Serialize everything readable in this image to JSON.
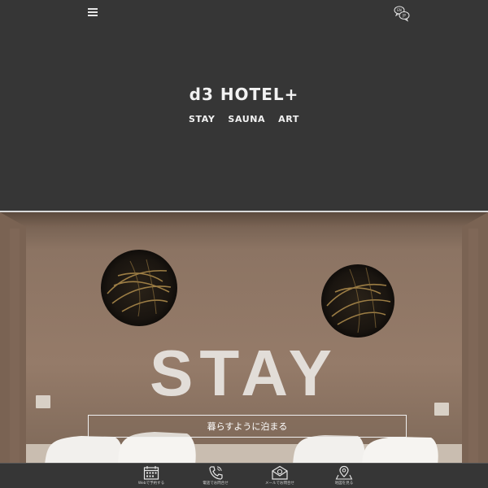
{
  "header": {
    "menu_icon": "hamburger-menu-icon",
    "language_icon": "language-speech-bubbles-icon",
    "language_codes": [
      "EN",
      "JP"
    ]
  },
  "brand": {
    "logo": "d3 HOTEL+",
    "nav": [
      "STAY",
      "SAUNA",
      "ART"
    ]
  },
  "hero": {
    "title": "STAY",
    "button_label": "暮らすように泊まる"
  },
  "bottom_bar": {
    "items": [
      {
        "icon": "calendar-icon",
        "label": "Webで予約する"
      },
      {
        "icon": "phone-icon",
        "label": "電話でお問合せ"
      },
      {
        "icon": "mail-icon",
        "label": "メールでお問合せ"
      },
      {
        "icon": "map-pin-icon",
        "label": "地図を見る"
      }
    ]
  },
  "colors": {
    "background": "#363636",
    "text": "#f2f2f2",
    "hero_wall": "#8a7261"
  }
}
